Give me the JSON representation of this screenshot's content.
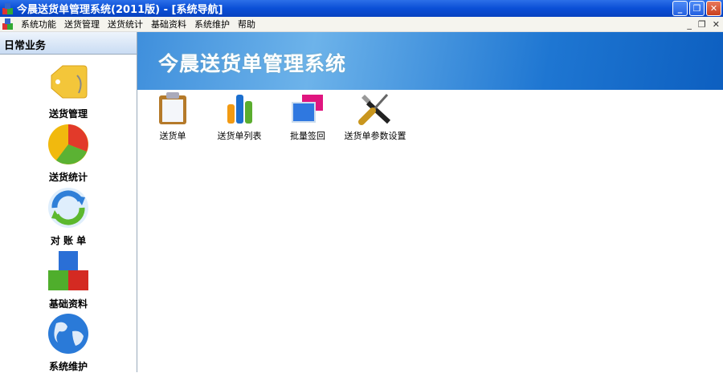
{
  "window": {
    "title": "今晨送货单管理系统(2011版) - [系统导航]",
    "buttons": [
      "_",
      "❐",
      "✕"
    ]
  },
  "menu": {
    "items": [
      "系统功能",
      "送货管理",
      "送货统计",
      "基础资料",
      "系统维护",
      "帮助"
    ],
    "mdi": [
      "_",
      "❐",
      "✕"
    ]
  },
  "sidebar": {
    "header": "日常业务",
    "items": [
      {
        "label": "送货管理",
        "icon": "folder-tag-icon"
      },
      {
        "label": "送货统计",
        "icon": "pie-chart-icon"
      },
      {
        "label": "对 账 单",
        "icon": "refresh-icon"
      },
      {
        "label": "基础资料",
        "icon": "blocks-icon"
      },
      {
        "label": "系统维护",
        "icon": "globe-icon"
      }
    ]
  },
  "banner": {
    "title": "今晨送货单管理系统"
  },
  "tools": [
    {
      "label": "送货单",
      "icon": "clipboard-icon"
    },
    {
      "label": "送货单列表",
      "icon": "bar-chart-icon"
    },
    {
      "label": "批量签回",
      "icon": "windows-icon"
    },
    {
      "label": "送货单参数设置",
      "icon": "tools-icon"
    }
  ]
}
